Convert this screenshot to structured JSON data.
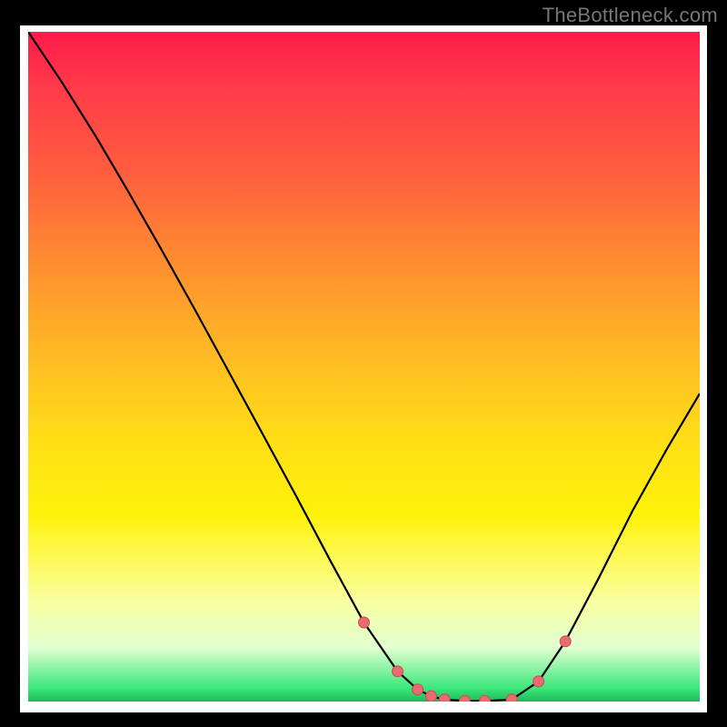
{
  "attribution": "TheBottleneck.com",
  "colors": {
    "curve_stroke": "#000000",
    "marker_fill": "#ea6a6f",
    "marker_stroke": "#c05054",
    "frame_black": "#000000",
    "frame_white": "#ffffff"
  },
  "chart_data": {
    "type": "line",
    "title": "",
    "xlabel": "",
    "ylabel": "",
    "x": [
      0.0,
      0.05,
      0.1,
      0.15,
      0.2,
      0.25,
      0.3,
      0.35,
      0.4,
      0.45,
      0.5,
      0.55,
      0.58,
      0.6,
      0.62,
      0.65,
      0.68,
      0.72,
      0.76,
      0.8,
      0.85,
      0.9,
      0.95,
      1.0
    ],
    "values": [
      1.0,
      0.925,
      0.845,
      0.76,
      0.672,
      0.582,
      0.49,
      0.398,
      0.305,
      0.21,
      0.118,
      0.045,
      0.018,
      0.008,
      0.003,
      0.001,
      0.001,
      0.003,
      0.03,
      0.09,
      0.185,
      0.285,
      0.375,
      0.46
    ],
    "xlim": [
      0,
      1
    ],
    "ylim": [
      0,
      1
    ],
    "marker_indices": [
      10,
      11,
      12,
      13,
      14,
      15,
      16,
      17,
      18,
      19
    ],
    "note": "x and y are normalized fractions of the plot area; no numeric axis labels are visible in the source image"
  }
}
